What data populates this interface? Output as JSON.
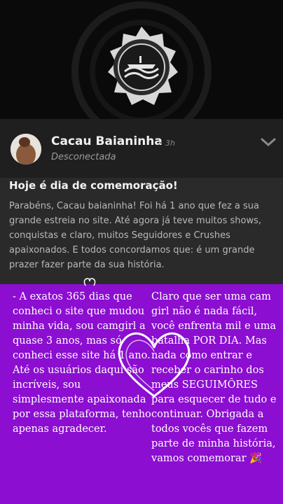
{
  "post": {
    "author": "Cacau Baianinha",
    "time": "3h",
    "status": "Desconectada",
    "title": "Hoje é dia de comemoração!",
    "body": "Parabéns, Cacau baianinha! Foi há 1 ano que fez a sua grande estreia no site. Até agora já teve muitos shows, conquistas e claro, muitos Seguidores e Crushes apaixonados. E todos concordamos que: é um grande prazer fazer parte da sua história."
  },
  "story": {
    "left_text": "- A exatos 365 dias que conheci o site que mudou minha vida, sou camgirl a quase 3 anos, mas só conheci esse site há 1 ano. Até os usuários daqui são incríveis, sou simplesmente apaixonada por essa plataforma, tenho apenas agradecer.",
    "right_text": "Claro que ser uma cam girl não é nada fácil, você enfrenta mil e uma batalha POR DIA. Mas nada como entrar e receber o carinho dos meus SEGUIMÔRES para esquecer de tudo e continuar. Obrigada a todos vocês que fazem parte de minha história, vamos comemorar 🎉"
  },
  "icons": {
    "logo": "site-logo-icon",
    "chevron": "chevron-down-icon",
    "heart": "heart-doodle-icon"
  },
  "colors": {
    "purple": "#8c0ed1",
    "card": "#2a2a2a"
  }
}
